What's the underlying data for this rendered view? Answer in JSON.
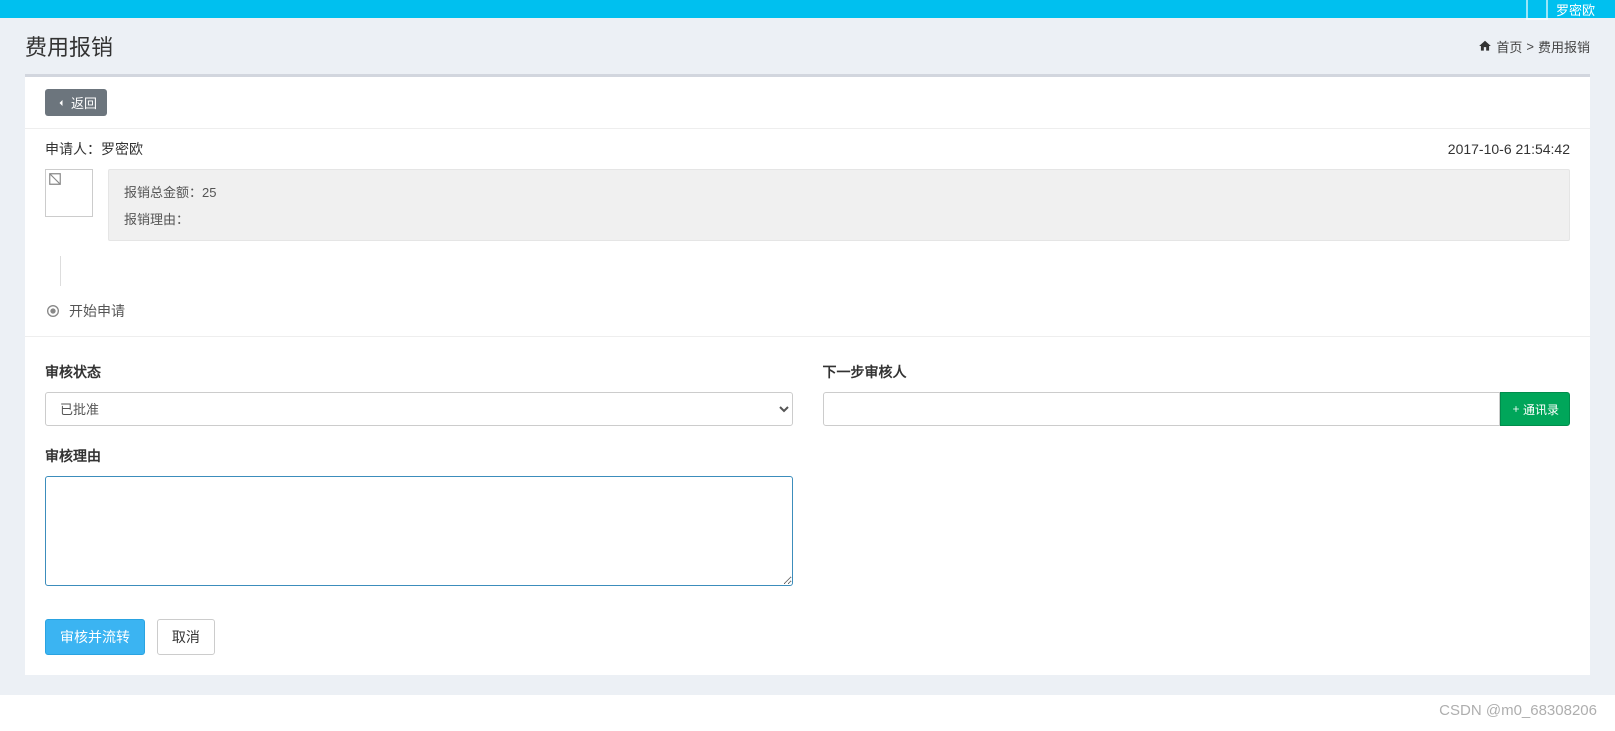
{
  "topbar": {
    "username": "罗密欧"
  },
  "page": {
    "title": "费用报销"
  },
  "breadcrumb": {
    "home": "首页",
    "current": "费用报销",
    "separator": ">"
  },
  "actions": {
    "back": "返回"
  },
  "request": {
    "applicant_label": "申请人：",
    "applicant_name": "罗密欧",
    "timestamp": "2017-10-6 21:54:42",
    "total_label": "报销总金额：",
    "total_amount": "25",
    "reason_label": "报销理由：",
    "reason_value": ""
  },
  "flow": {
    "start_label": "开始申请"
  },
  "form": {
    "status_label": "审核状态",
    "status_selected": "已批准",
    "status_options": [
      "已批准"
    ],
    "next_approver_label": "下一步审核人",
    "next_approver_value": "",
    "contacts_btn": "通讯录",
    "reason_label": "审核理由",
    "reason_value": ""
  },
  "buttons": {
    "submit": "审核并流转",
    "cancel": "取消"
  },
  "watermark": "CSDN @m0_68308206"
}
